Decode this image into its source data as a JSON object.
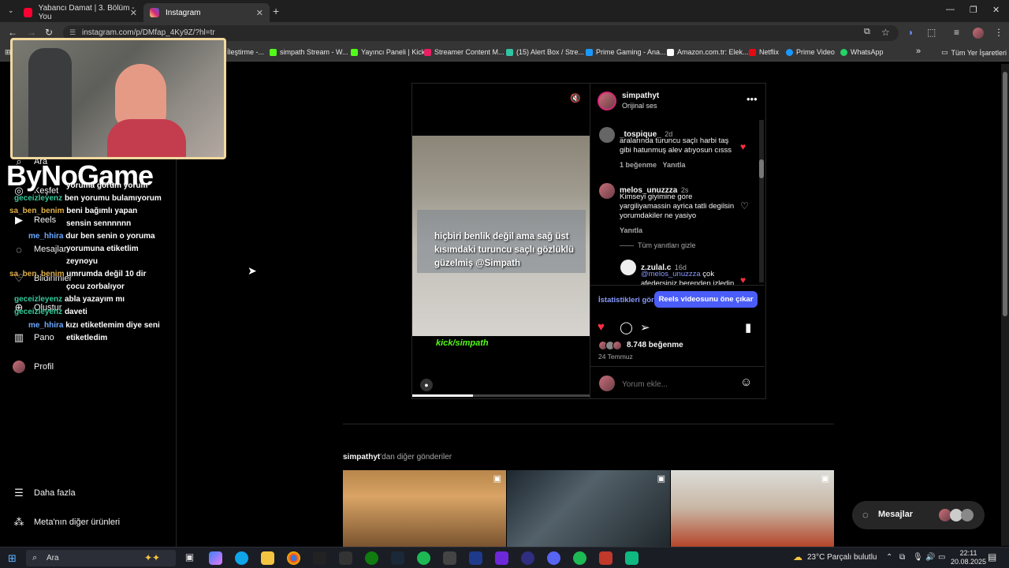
{
  "browser": {
    "tabs": [
      {
        "title": "Yabancı Damat | 3. Bölüm - You",
        "favicon_color": "#ff0033"
      },
      {
        "title": "Instagram",
        "favicon_color": "#d62976"
      }
    ],
    "url": "instagram.com/p/DMfap_4Ky9Z/?hl=tr",
    "bookmarks": [
      {
        "label": "İleştirme -...",
        "color": "#888888"
      },
      {
        "label": "simpath Stream - W...",
        "color": "#53fc18"
      },
      {
        "label": "Yayıncı Paneli | Kick",
        "color": "#53fc18"
      },
      {
        "label": "Streamer Content M...",
        "color": "#e91e63"
      },
      {
        "label": "(15) Alert Box / Stre...",
        "color": "#31c3a2"
      },
      {
        "label": "Prime Gaming - Ana...",
        "color": "#1a98ff"
      },
      {
        "label": "Amazon.com.tr: Elek...",
        "color": "#ffffff"
      },
      {
        "label": "Netflix",
        "color": "#e50914"
      },
      {
        "label": "Prime Video",
        "color": "#1a98ff"
      },
      {
        "label": "WhatsApp",
        "color": "#25d366"
      }
    ],
    "all_bookmarks": "Tüm Yer İşaretleri"
  },
  "sidebar": {
    "items": [
      {
        "label": "Ara",
        "icon": "search-icon"
      },
      {
        "label": "Keşfet",
        "icon": "compass-icon"
      },
      {
        "label": "Reels",
        "icon": "reels-icon"
      },
      {
        "label": "Mesajlar",
        "icon": "messenger-icon"
      },
      {
        "label": "Bildirimler",
        "icon": "heart-icon"
      },
      {
        "label": "Oluştur",
        "icon": "plus-icon"
      },
      {
        "label": "Pano",
        "icon": "chart-icon"
      },
      {
        "label": "Profil",
        "icon": "avatar-icon"
      }
    ],
    "more": "Daha fazla",
    "meta": "Meta'nın diğer ürünleri"
  },
  "overlay": {
    "logo": "ByNoGame",
    "chat": [
      {
        "user": "",
        "msg": "yoruma görüm yorum"
      },
      {
        "user": "geceizleyenz",
        "msg": "ben yorumu bulamıyorum"
      },
      {
        "user": "sa_ben_benim",
        "msg": "beni bağımlı yapan"
      },
      {
        "user": "",
        "msg": "sensin sennnnnn"
      },
      {
        "user": "me_hhira",
        "msg": "dur ben senin o yoruma"
      },
      {
        "user": "",
        "msg": "yorumuna etiketlim"
      },
      {
        "user": "",
        "msg": "zeynoyu"
      },
      {
        "user": "sa_ben_benim",
        "msg": "umrumda değil 10 dir"
      },
      {
        "user": "",
        "msg": "çocu zorbalıyor"
      },
      {
        "user": "geceizleyenz",
        "msg": "abla yazayım mı"
      },
      {
        "user": "geceizleyenz",
        "msg": "daveti"
      },
      {
        "user": "me_hhira",
        "msg": "kızı etiketlemim diye seni"
      },
      {
        "user": "",
        "msg": "etiketledim"
      }
    ]
  },
  "post": {
    "username": "simpathyt",
    "audio": "Orijinal ses",
    "video_caption": "hiçbiri benlik değil ama sağ üst kısımdaki turuncu saçlı gözlüklü güzelmiş @Simpath",
    "video_brand": "kick/simpath",
    "progress": 0.34,
    "comments": [
      {
        "user": "_tospique_",
        "time": "2d",
        "text": "aralarında turuncu saçlı harbi taş gibi hatunmuş alev atıyosun cısss",
        "likes": "1 beğenme",
        "reply": "Yanıtla",
        "liked": true
      },
      {
        "user": "melos_unuzzza",
        "time": "2s",
        "text": "Kimseyi giyimine gore yargiliyamassin ayrica tatli degilsin yorumdakiler ne yasiyo",
        "likes": "",
        "reply": "Yanıtla",
        "liked": false
      },
      {
        "user": "z.zulal.c",
        "time": "16d",
        "mention": "@melos_unuzzza",
        "text": " çok afedersiniz berenden izledin",
        "liked": true
      }
    ],
    "hide_replies": "Tüm yanıtları gizle",
    "insights": "İstatistikleri gör",
    "boost": "Reels videosunu öne çıkar",
    "likes": "8.748 beğenme",
    "date": "24 Temmuz",
    "comment_placeholder": "Yorum ekle..."
  },
  "more_posts": {
    "user": "simpathyt",
    "suffix": "'dan diğer gönderiler"
  },
  "messages_pill": "Mesajlar",
  "taskbar": {
    "search": "Ara",
    "weather": "23°C  Parçalı bulutlu",
    "time": "22:11",
    "date": "20.08.2025"
  }
}
